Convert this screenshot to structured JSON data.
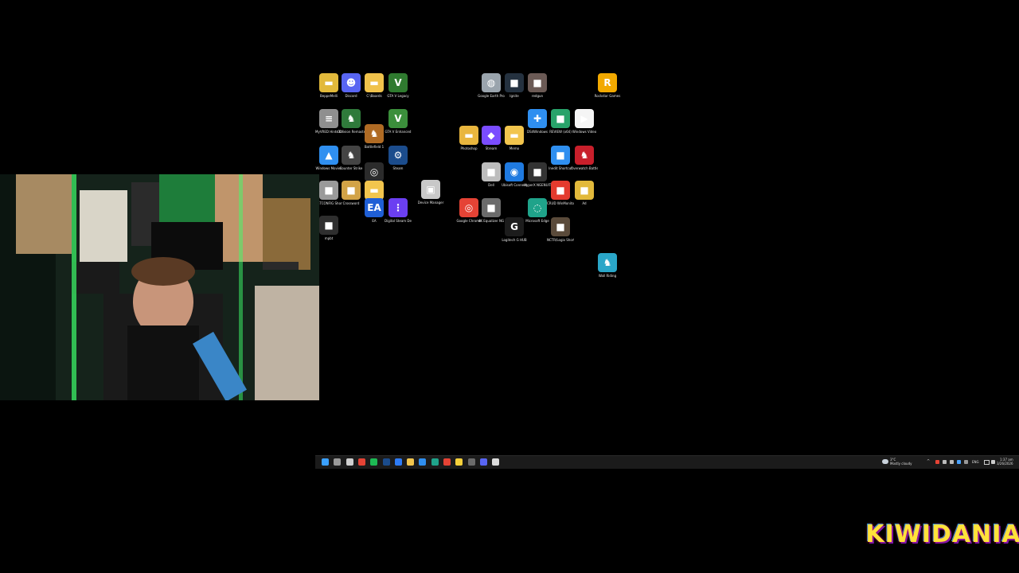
{
  "desktop_icons": [
    {
      "label": "BeppeMelli",
      "icon": "folder-icon",
      "color": "#e2b93b"
    },
    {
      "label": "Discord",
      "icon": "discord-icon",
      "color": "#5865f2"
    },
    {
      "label": "C:\\Boards",
      "icon": "folder-icon",
      "color": "#f0c24b"
    },
    {
      "label": "GTA V Legacy",
      "icon": "gta-icon",
      "color": "#2f7a2f"
    },
    {
      "label": "Google Earth Pro",
      "icon": "earth-icon",
      "color": "#9aa4ad"
    },
    {
      "label": "Ignite",
      "icon": "app-icon",
      "color": "#24313f"
    },
    {
      "label": "redgun",
      "icon": "app-icon",
      "color": "#6b5a55"
    },
    {
      "label": "Rockstar Games",
      "icon": "rockstar-icon",
      "color": "#f2a900"
    },
    {
      "label": "MyVRED Hints CHANGELOG",
      "icon": "file-icon",
      "color": "#8f8f8f"
    },
    {
      "label": "Oblivion Remastered",
      "icon": "game-icon",
      "color": "#2f7a3b"
    },
    {
      "label": "Battlefield 1",
      "icon": "game-icon",
      "color": "#b06b24"
    },
    {
      "label": "GTA V Enhanced",
      "icon": "gta-icon",
      "color": "#3b8f3b"
    },
    {
      "label": "Photoshop",
      "icon": "folder-icon",
      "color": "#e9b63e"
    },
    {
      "label": "Stream",
      "icon": "stream-icon",
      "color": "#7a4cff"
    },
    {
      "label": "Memo",
      "icon": "folder-icon",
      "color": "#f2c54d"
    },
    {
      "label": "DS4Windows",
      "icon": "controller-icon",
      "color": "#2f8ff0"
    },
    {
      "label": "REVIEW (x64)",
      "icon": "app-icon",
      "color": "#28a36a"
    },
    {
      "label": "Windows Video",
      "icon": "play-icon",
      "color": "#f5f5f5"
    },
    {
      "label": "Windows Movies",
      "icon": "image-icon",
      "color": "#2f8ff0"
    },
    {
      "label": "Counter Strike",
      "icon": "game-icon",
      "color": "#444"
    },
    {
      "label": "OBS",
      "icon": "obs-icon",
      "color": "#2b2b2b"
    },
    {
      "label": "Steam",
      "icon": "steam-icon",
      "color": "#1b4c8c"
    },
    {
      "label": "Dell",
      "icon": "app-icon",
      "color": "#bdbdbd"
    },
    {
      "label": "Ubisoft Connect",
      "icon": "ubisoft-icon",
      "color": "#1f7ae0"
    },
    {
      "label": "HyperX NGENUITY",
      "icon": "app-icon",
      "color": "#333"
    },
    {
      "label": "Inedit Shortcut",
      "icon": "app-icon",
      "color": "#2f8ff0"
    },
    {
      "label": "Overwatch Battle Academy",
      "icon": "game-icon",
      "color": "#c81f2b"
    },
    {
      "label": "NETCONFIG Shortcut",
      "icon": "app-icon",
      "color": "#9a9a9a"
    },
    {
      "label": "Crossword",
      "icon": "app-icon",
      "color": "#d2a347"
    },
    {
      "label": "C:\\Users",
      "icon": "folder-icon",
      "color": "#f2c54d"
    },
    {
      "label": "Device Manager",
      "icon": "device-icon",
      "color": "#c8c8c8"
    },
    {
      "label": "Google Chrome",
      "icon": "chrome-icon",
      "color": "#e54335"
    },
    {
      "label": "4K Equalizer NG",
      "icon": "app-icon",
      "color": "#6b6b6b"
    },
    {
      "label": "Microsoft Edge",
      "icon": "edge-icon",
      "color": "#1fa38a"
    },
    {
      "label": "CRUD WinMonitor",
      "icon": "app-icon",
      "color": "#e43b2e"
    },
    {
      "label": "Ad",
      "icon": "app-icon",
      "color": "#e2b93b"
    },
    {
      "label": "EA",
      "icon": "ea-icon",
      "color": "#1f5fd6"
    },
    {
      "label": "Digital Steam Deck",
      "icon": "grid-icon",
      "color": "#6b3ff2"
    },
    {
      "label": "Logitech G HUB",
      "icon": "logitech-icon",
      "color": "#1c1c1c"
    },
    {
      "label": "NCTR/Logix Shortcut",
      "icon": "app-icon",
      "color": "#5a4a3a"
    },
    {
      "label": "Wall Riding",
      "icon": "game-icon",
      "color": "#2aa6c8"
    },
    {
      "label": "mpbt",
      "icon": "app-icon",
      "color": "#2e2e2e"
    }
  ],
  "taskbar": {
    "apps": [
      {
        "icon": "windows-start-icon",
        "color": "#3aa0ff"
      },
      {
        "icon": "task-view-icon",
        "color": "#9a9a9a"
      },
      {
        "icon": "shield-icon",
        "color": "#cfcfcf"
      },
      {
        "icon": "app-icon",
        "color": "#e54335"
      },
      {
        "icon": "spotify-icon",
        "color": "#1db954"
      },
      {
        "icon": "steam-icon",
        "color": "#1b4c8c"
      },
      {
        "icon": "app-icon",
        "color": "#2e7cf6"
      },
      {
        "icon": "folder-icon",
        "color": "#f2c54d"
      },
      {
        "icon": "store-icon",
        "color": "#2f8ff0"
      },
      {
        "icon": "edge-icon",
        "color": "#1fa38a"
      },
      {
        "icon": "chrome-icon",
        "color": "#e54335"
      },
      {
        "icon": "app-icon",
        "color": "#f5d03b"
      },
      {
        "icon": "app-icon",
        "color": "#6b6b6b"
      },
      {
        "icon": "discord-icon",
        "color": "#5865f2"
      },
      {
        "icon": "app-icon",
        "color": "#dcdcdc"
      }
    ],
    "weather_temp": "3°C",
    "weather_desc": "Mostly cloudy",
    "language": "ENG",
    "time": "1:37 am",
    "date": "3/26/2026"
  },
  "branding": {
    "text": "KIWIDANIA"
  }
}
